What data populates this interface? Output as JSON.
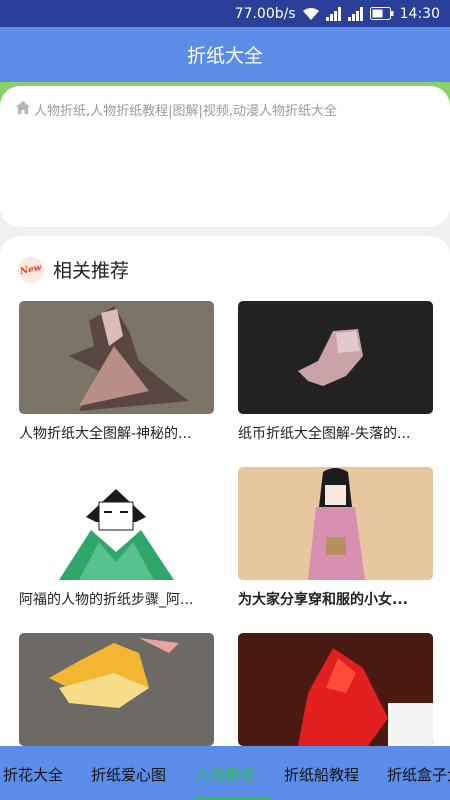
{
  "status_bar": {
    "speed": "77.00b/s",
    "time": "14:30"
  },
  "app_bar": {
    "title": "折纸大全"
  },
  "breadcrumb": {
    "text": "人物折纸,人物折纸教程|图解|视频,动漫人物折纸大全",
    "icon": "home-icon"
  },
  "recommend": {
    "badge": "New",
    "title": "相关推荐",
    "items": [
      {
        "caption": "人物折纸大全图解-神秘的...",
        "bold": false
      },
      {
        "caption": "纸币折纸大全图解-失落的...",
        "bold": false
      },
      {
        "caption": "阿福的人物的折纸步骤_阿...",
        "bold": false
      },
      {
        "caption": "为大家分享穿和服的小女...",
        "bold": true
      },
      {
        "caption": "",
        "bold": false
      },
      {
        "caption": "",
        "bold": false
      }
    ]
  },
  "bottom_nav": {
    "items": [
      "折花大全",
      "折纸爱心图",
      "人物折纸",
      "折纸船教程",
      "折纸盒子大全"
    ],
    "active_index": 2
  },
  "colors": {
    "status_bar": "#2a3f9a",
    "app_bar": "#5b8de8",
    "active_tab": "#2fbf4e"
  }
}
